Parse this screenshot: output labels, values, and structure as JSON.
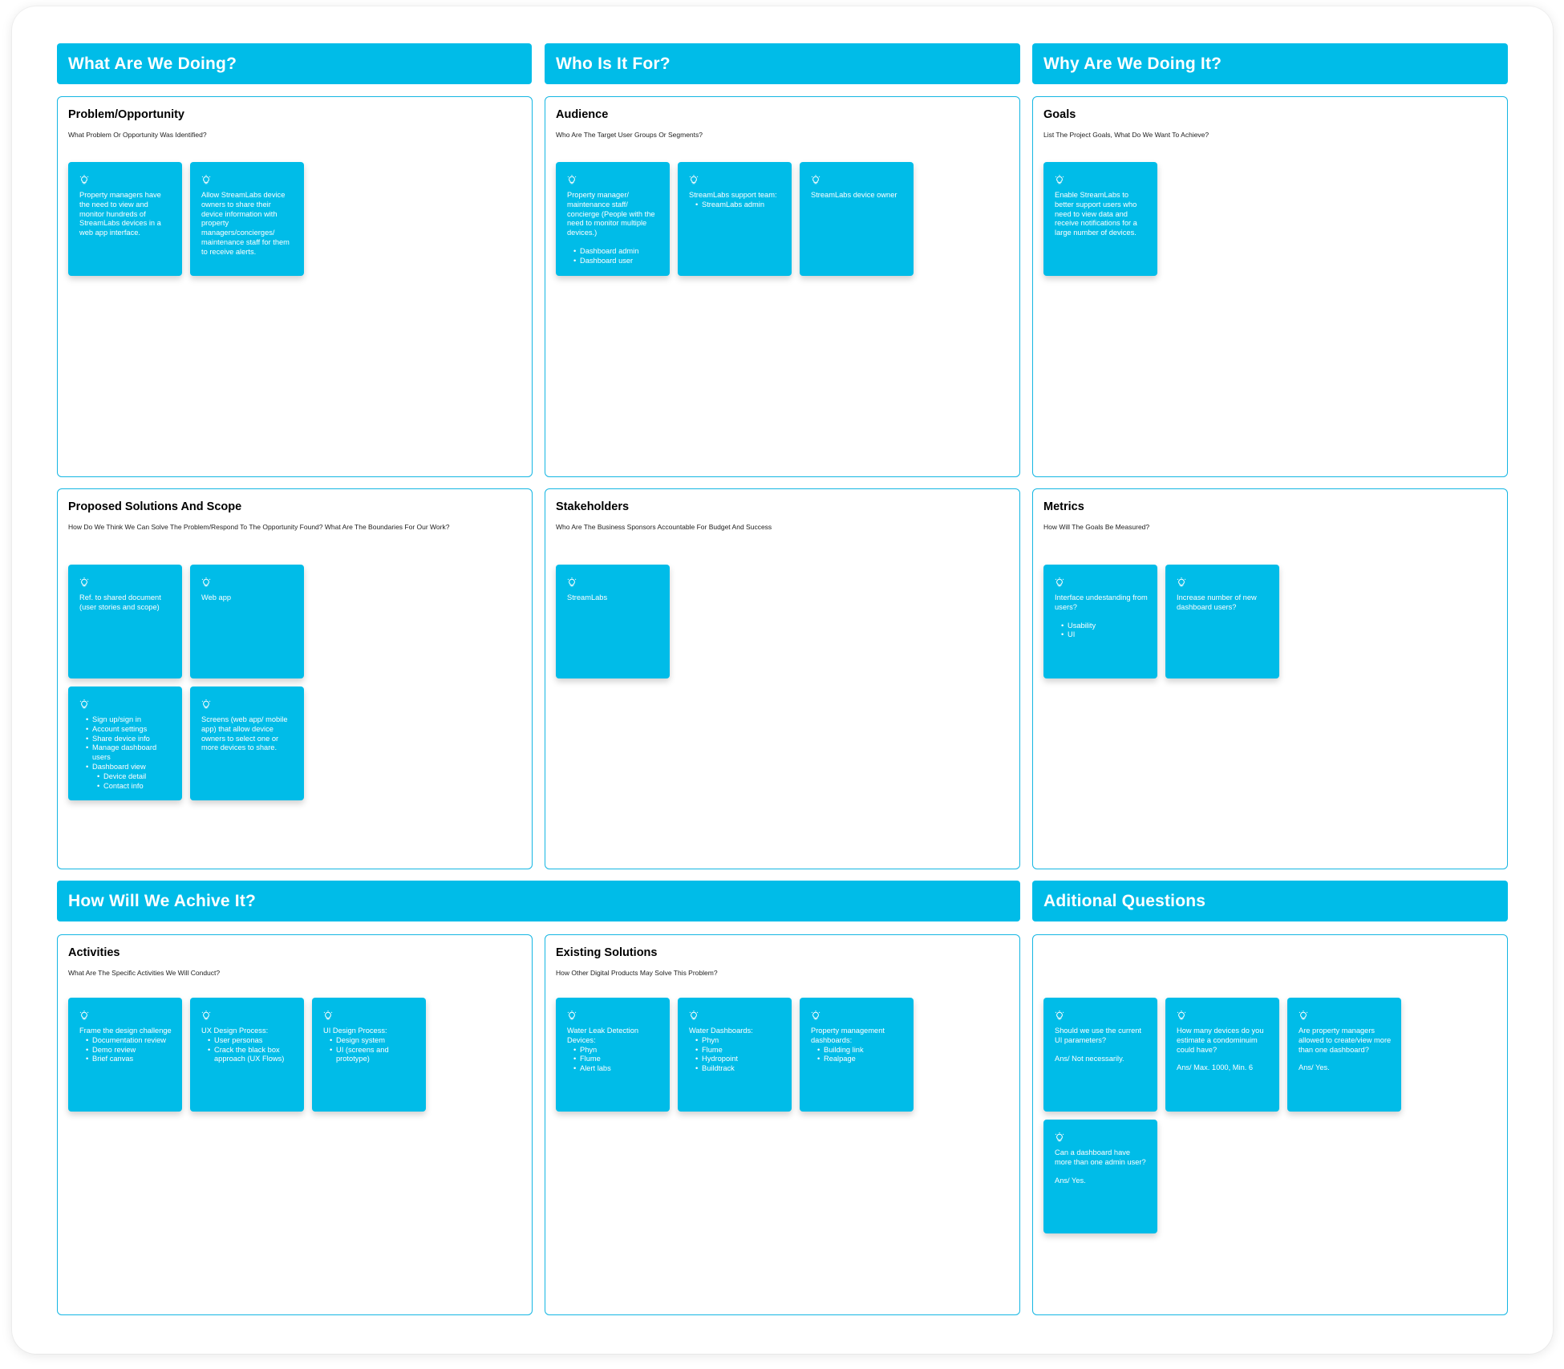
{
  "headers": {
    "what": "What Are We Doing?",
    "who": "Who Is It For?",
    "why": "Why Are We Doing It?",
    "how": "How Will We Achive It?",
    "questions": "Aditional Questions"
  },
  "panels": {
    "problem": {
      "title": "Problem/Opportunity",
      "subtitle": "What Problem Or Opportunity Was Identified?",
      "cards": [
        {
          "text": "Property managers have the need to view and monitor hundreds of StreamLabs devices in a web app interface."
        },
        {
          "text": "Allow StreamLabs device owners to share their device information with property managers/concierges/ maintenance staff for them to receive alerts."
        }
      ]
    },
    "audience": {
      "title": "Audience",
      "subtitle": "Who Are The Target User Groups Or Segments?",
      "cards": [
        {
          "text": "Property manager/ maintenance staff/ concierge (People with the need to monitor multiple devices.)",
          "items": [
            "Dashboard admin",
            "Dashboard user"
          ]
        },
        {
          "text": "StreamLabs support team:",
          "items": [
            "StreamLabs admin"
          ]
        },
        {
          "text": "StreamLabs device owner"
        }
      ]
    },
    "goals": {
      "title": "Goals",
      "subtitle": "List The Project Goals, What Do We Want To Achieve?",
      "cards": [
        {
          "text": "Enable StreamLabs to better support users who need to view data and receive notifications for a large number of devices."
        }
      ]
    },
    "solutions": {
      "title": "Proposed Solutions And Scope",
      "subtitle": "How Do We Think We Can Solve The Problem/Respond To The Opportunity Found? What Are The Boundaries For Our Work?",
      "cards": [
        {
          "text": "Ref. to shared document (user stories and scope)"
        },
        {
          "text": "Web app"
        },
        {
          "items": [
            "Sign up/sign in",
            "Account settings",
            "Share device info",
            "Manage dashboard users",
            "Dashboard view"
          ],
          "subitems": [
            "Device detail",
            "Contact info"
          ]
        },
        {
          "text": "Screens (web app/ mobile app) that allow device owners to select one or more devices to share."
        }
      ]
    },
    "stakeholders": {
      "title": "Stakeholders",
      "subtitle": "Who Are The Business Sponsors Accountable For Budget And Success",
      "cards": [
        {
          "text": "StreamLabs"
        }
      ]
    },
    "metrics": {
      "title": "Metrics",
      "subtitle": "How Will The Goals Be Measured?",
      "cards": [
        {
          "text": "Interface undestanding from users?",
          "items": [
            "Usability",
            "UI"
          ]
        },
        {
          "text": "Increase number of new dashboard users?"
        }
      ]
    },
    "activities": {
      "title": "Activities",
      "subtitle": "What Are The Specific Activities We Will Conduct?",
      "cards": [
        {
          "text": "Frame the design challenge",
          "items": [
            "Documentation review",
            "Demo review",
            "Brief canvas"
          ]
        },
        {
          "text": "UX Design Process:",
          "items": [
            "User personas",
            "Crack the black box approach (UX Flows)"
          ]
        },
        {
          "text": "UI Design Process:",
          "items": [
            "Design system",
            "UI (screens and prototype)"
          ]
        }
      ]
    },
    "existing": {
      "title": "Existing Solutions",
      "subtitle": "How Other Digital Products May Solve This Problem?",
      "cards": [
        {
          "text": "Water Leak Detection Devices:",
          "items": [
            "Phyn",
            "Flume",
            "Alert labs"
          ]
        },
        {
          "text": "Water Dashboards:",
          "items": [
            "Phyn",
            "Flume",
            "Hydropoint",
            "Buildtrack"
          ]
        },
        {
          "text": "Property management dashboards:",
          "items": [
            "Building link",
            "Realpage"
          ]
        }
      ]
    },
    "questions": {
      "cards": [
        {
          "text": "Should we use the current UI parameters?",
          "answer": "Ans/ Not necessarily."
        },
        {
          "text": "How many devices do you estimate a condominuim could have?",
          "answer": "Ans/ Max. 1000, Min. 6"
        },
        {
          "text": "Are property managers allowed to create/view more than one dashboard?",
          "answer": "Ans/ Yes."
        },
        {
          "text": "Can a dashboard have more than one admin user?",
          "answer": "Ans/ Yes."
        }
      ]
    }
  },
  "colors": {
    "accent": "#00bce8",
    "border": "#14b6e3",
    "card_text": "#ffffff"
  },
  "icons": {
    "card": "lightbulb-icon"
  }
}
